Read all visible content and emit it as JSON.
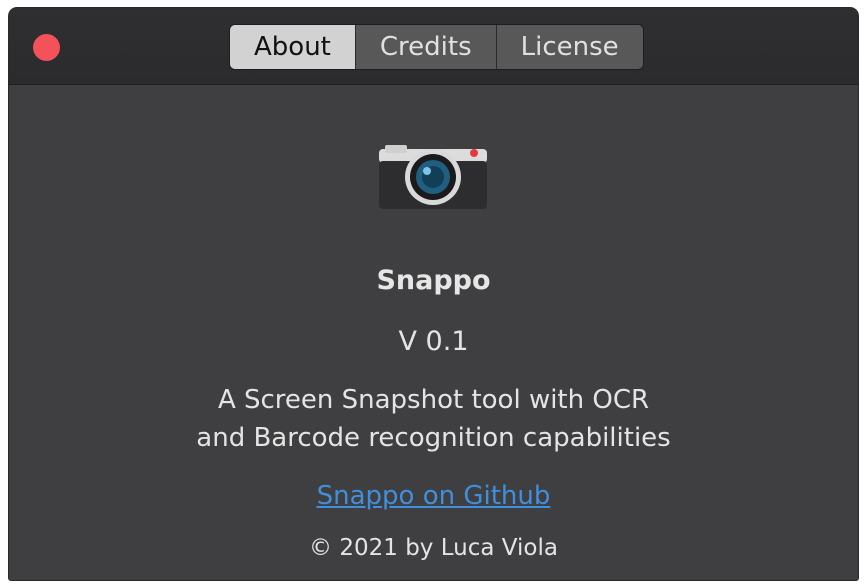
{
  "window": {
    "tabs": [
      {
        "label": "About",
        "active": true
      },
      {
        "label": "Credits",
        "active": false
      },
      {
        "label": "License",
        "active": false
      }
    ],
    "close_icon": "close-icon",
    "accent_close": "#f4525a"
  },
  "about": {
    "app_icon": "camera-icon",
    "app_name": "Snappo",
    "version": "V 0.1",
    "description_line1": "A Screen Snapshot tool with OCR",
    "description_line2": "and Barcode recognition capabilities",
    "link_text": "Snappo on Github",
    "link_color": "#3f8fdc",
    "copyright": "© 2021 by Luca Viola"
  }
}
